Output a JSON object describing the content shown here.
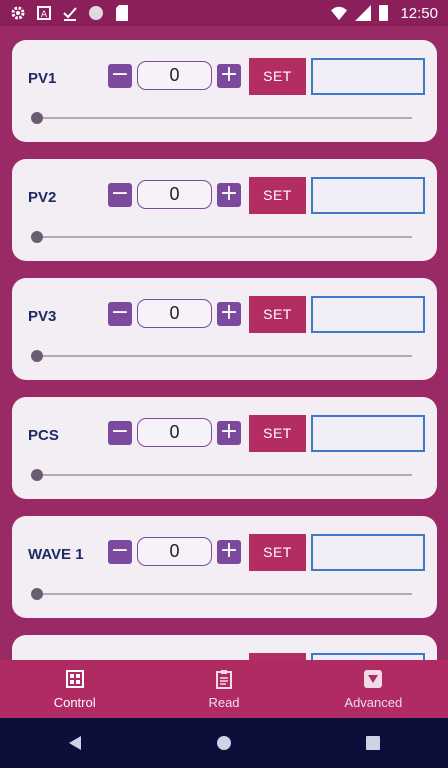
{
  "status_bar": {
    "time": "12:50",
    "left_icons": [
      "gear-icon",
      "a-box-icon",
      "check-icon",
      "circle-icon",
      "sd-card-icon"
    ],
    "right_icons": [
      "wifi-icon",
      "signal-icon",
      "battery-icon"
    ]
  },
  "controls": {
    "minus_label": "−",
    "plus_label": "+",
    "set_label": "SET"
  },
  "cards": [
    {
      "label": "PV1",
      "value": "0",
      "slider_fraction": 0
    },
    {
      "label": "PV2",
      "value": "0",
      "slider_fraction": 0
    },
    {
      "label": "PV3",
      "value": "0",
      "slider_fraction": 0
    },
    {
      "label": "PCS",
      "value": "0",
      "slider_fraction": 0
    },
    {
      "label": "WAVE 1",
      "value": "0",
      "slider_fraction": 0
    }
  ],
  "bottom_nav": {
    "items": [
      {
        "label": "Control",
        "icon": "grid-icon",
        "active": true
      },
      {
        "label": "Read",
        "icon": "clipboard-icon",
        "active": false
      },
      {
        "label": "Advanced",
        "icon": "triangle-box-icon",
        "active": false
      }
    ]
  },
  "system_nav": [
    "back-icon",
    "home-icon",
    "recents-icon"
  ],
  "colors": {
    "primary": "#b02a63",
    "accent": "#7b4a9f",
    "field_border": "#3f78c8",
    "card": "#f3eef4"
  }
}
